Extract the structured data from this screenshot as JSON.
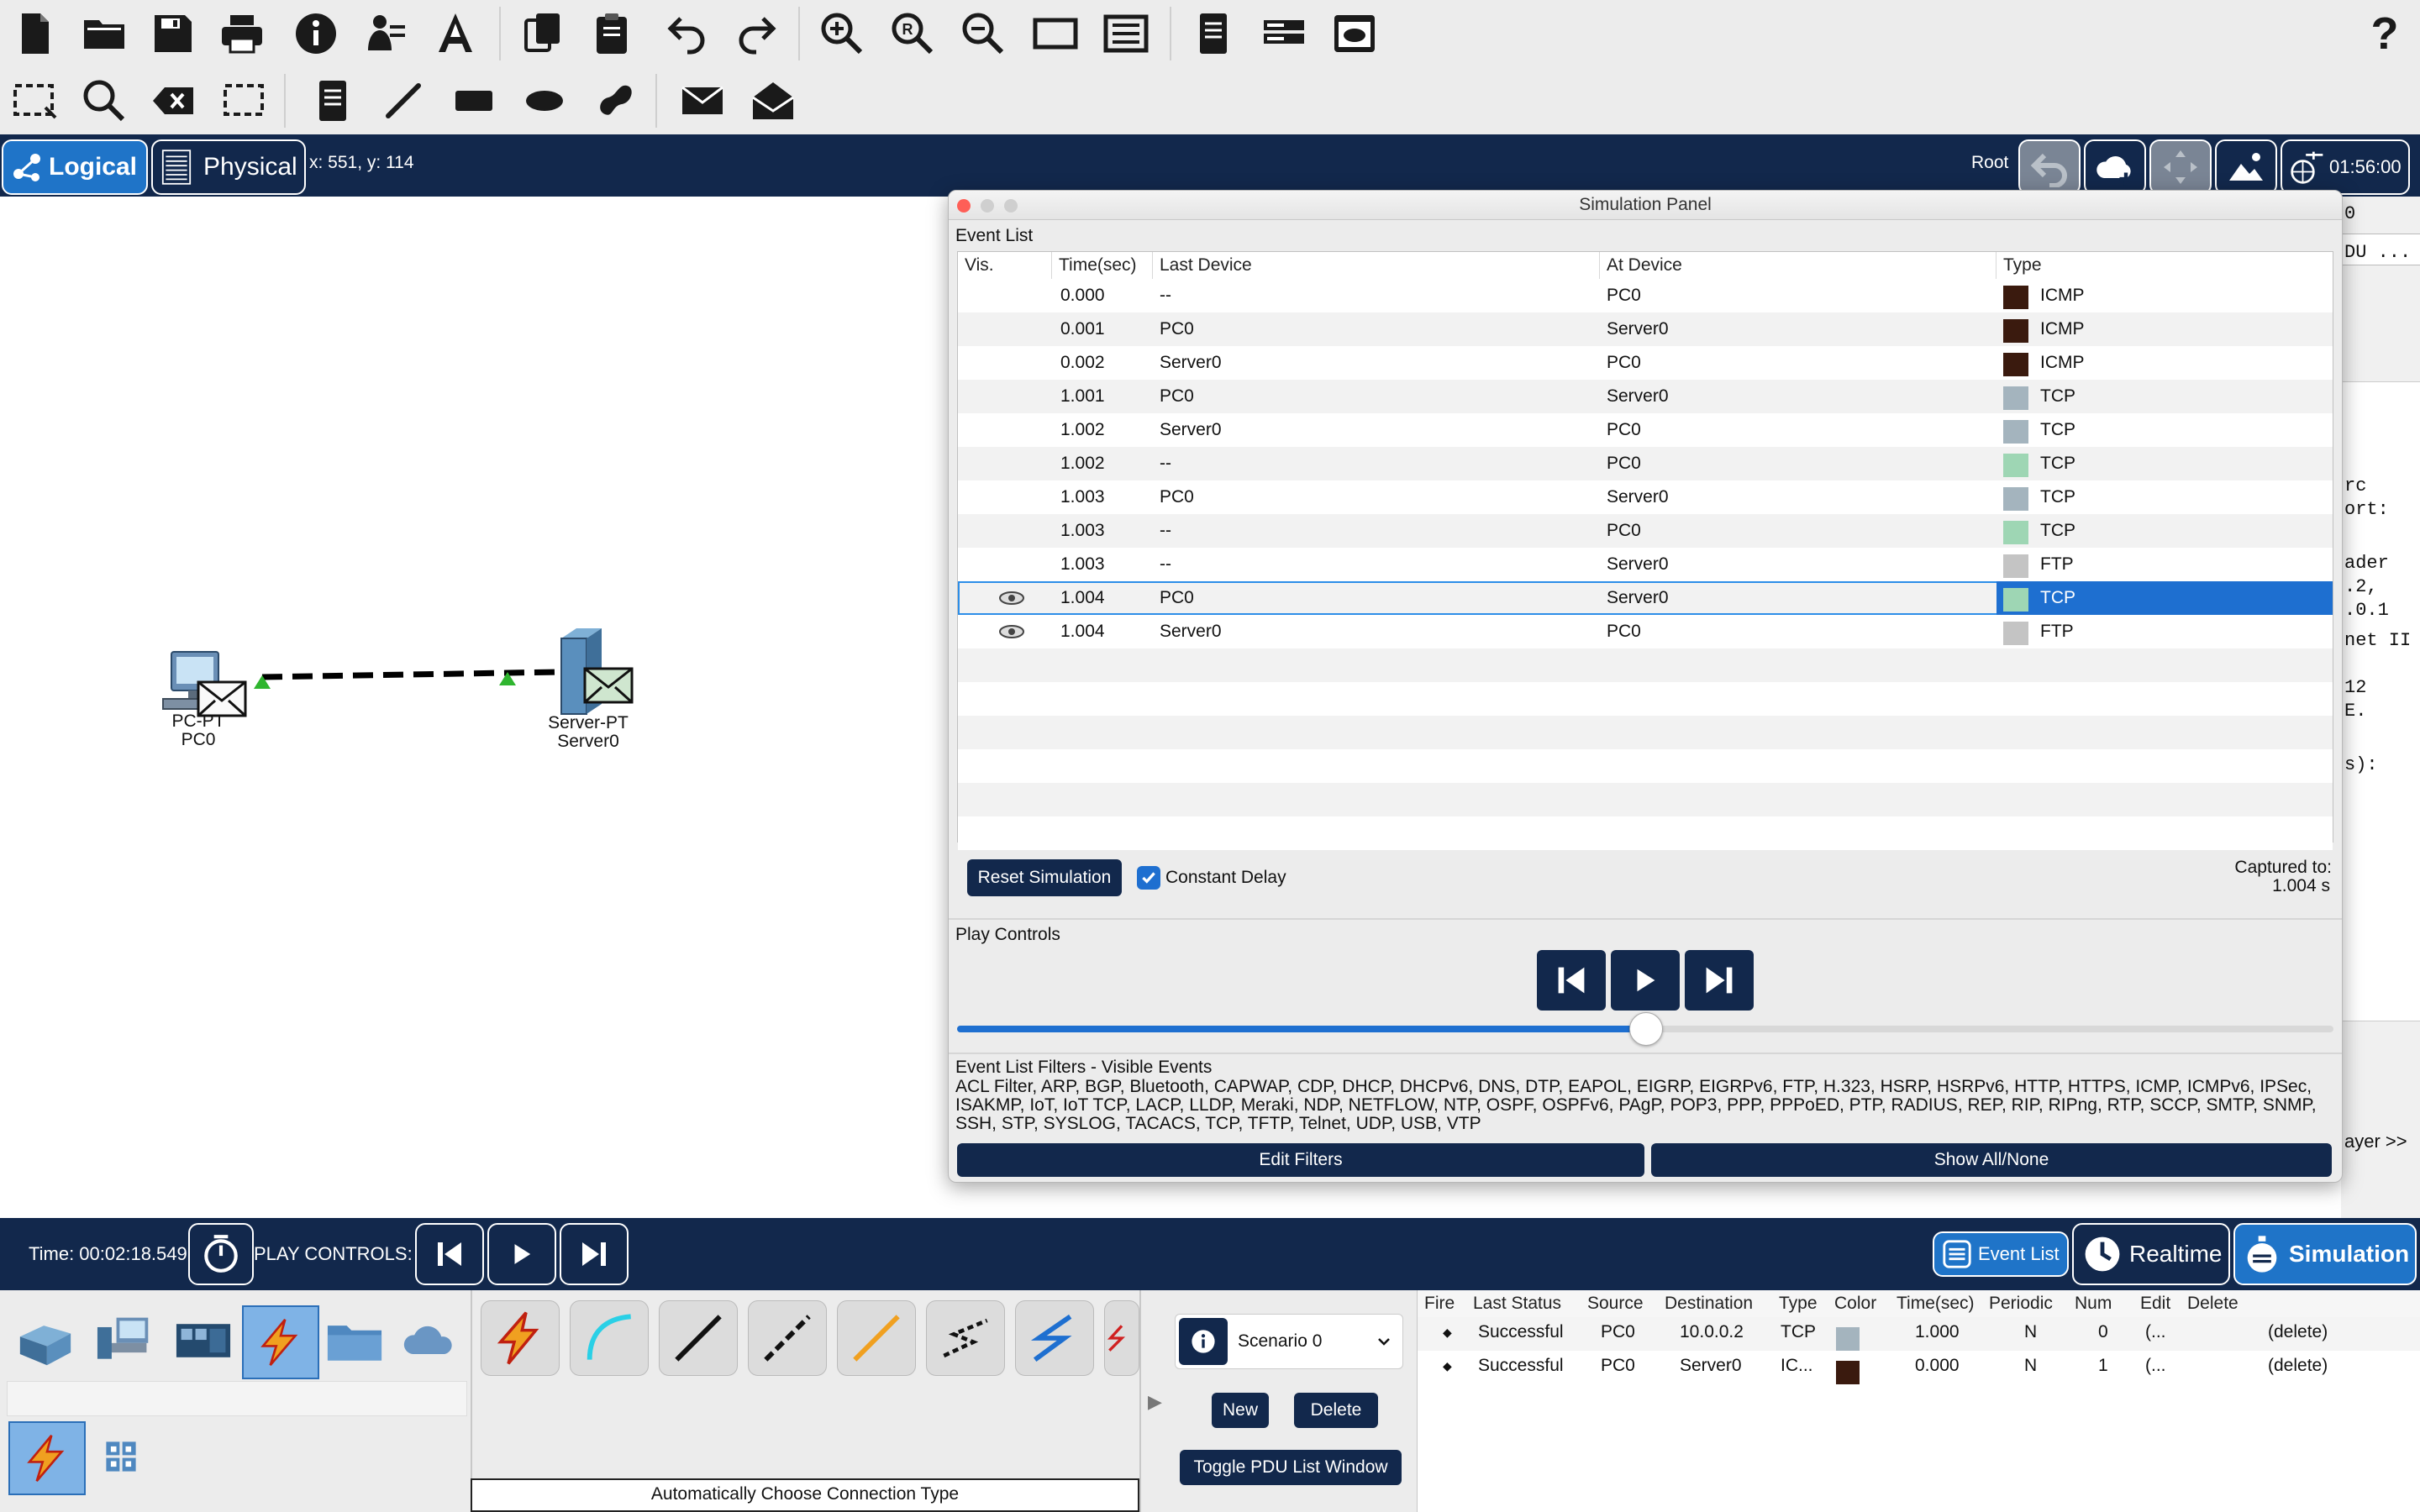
{
  "toolbar_icons": [
    "new-file",
    "open-folder",
    "save",
    "print",
    "info",
    "activity-wizard",
    "text-a",
    "copy",
    "paste",
    "undo",
    "redo",
    "zoom-in",
    "zoom-reset",
    "zoom-out",
    "window",
    "list-view",
    "notes",
    "device-rack",
    "cloud-window",
    "help"
  ],
  "help_label": "?",
  "nav": {
    "logical_label": "Logical",
    "physical_label": "Physical",
    "coords": "x: 551, y: 114",
    "root_label": "Root",
    "clock": "01:56:00"
  },
  "devices": {
    "pc": {
      "type": "PC-PT",
      "name": "PC0"
    },
    "server": {
      "type": "Server-PT",
      "name": "Server0"
    }
  },
  "sim_panel": {
    "title": "Simulation Panel",
    "event_list_label": "Event List",
    "columns": [
      "Vis.",
      "Time(sec)",
      "Last Device",
      "At Device",
      "Type"
    ],
    "events": [
      {
        "time": "0.000",
        "last": "--",
        "at": "PC0",
        "type": "ICMP",
        "color": "#3a1a0e",
        "vis": false,
        "selected": false
      },
      {
        "time": "0.001",
        "last": "PC0",
        "at": "Server0",
        "type": "ICMP",
        "color": "#3a1a0e",
        "vis": false,
        "selected": false
      },
      {
        "time": "0.002",
        "last": "Server0",
        "at": "PC0",
        "type": "ICMP",
        "color": "#3a1a0e",
        "vis": false,
        "selected": false
      },
      {
        "time": "1.001",
        "last": "PC0",
        "at": "Server0",
        "type": "TCP",
        "color": "#a4b4be",
        "vis": false,
        "selected": false
      },
      {
        "time": "1.002",
        "last": "Server0",
        "at": "PC0",
        "type": "TCP",
        "color": "#a4b4be",
        "vis": false,
        "selected": false
      },
      {
        "time": "1.002",
        "last": "--",
        "at": "PC0",
        "type": "TCP",
        "color": "#9ed6b4",
        "vis": false,
        "selected": false
      },
      {
        "time": "1.003",
        "last": "PC0",
        "at": "Server0",
        "type": "TCP",
        "color": "#a4b4be",
        "vis": false,
        "selected": false
      },
      {
        "time": "1.003",
        "last": "--",
        "at": "PC0",
        "type": "TCP",
        "color": "#9ed6b4",
        "vis": false,
        "selected": false
      },
      {
        "time": "1.003",
        "last": "--",
        "at": "Server0",
        "type": "FTP",
        "color": "#c4c4c4",
        "vis": false,
        "selected": false
      },
      {
        "time": "1.004",
        "last": "PC0",
        "at": "Server0",
        "type": "TCP",
        "color": "#9ed6b4",
        "vis": true,
        "selected": true
      },
      {
        "time": "1.004",
        "last": "Server0",
        "at": "PC0",
        "type": "FTP",
        "color": "#c4c4c4",
        "vis": true,
        "selected": false
      }
    ],
    "reset_label": "Reset Simulation",
    "constant_delay_label": "Constant Delay",
    "constant_delay_checked": true,
    "captured_label": "Captured to:",
    "captured_value": "1.004 s",
    "play_controls_label": "Play Controls",
    "playback_progress": 0.5,
    "filters_label": "Event List Filters - Visible Events",
    "filters_text": "ACL Filter, ARP, BGP, Bluetooth, CAPWAP, CDP, DHCP, DHCPv6, DNS, DTP, EAPOL, EIGRP, EIGRPv6, FTP, H.323, HSRP, HSRPv6, HTTP, HTTPS, ICMP, ICMPv6, IPSec, ISAKMP, IoT, IoT TCP, LACP, LLDP, Meraki, NDP, NETFLOW, NTP, OSPF, OSPFv6, PAgP, POP3, PPP, PPPoED, PTP, RADIUS, REP, RIP, RIPng, RTP, SCCP, SMTP, SNMP, SSH, STP, SYSLOG, TACACS, TCP, TFTP, Telnet, UDP, USB, VTP",
    "edit_filters_label": "Edit Filters",
    "show_all_label": "Show All/None"
  },
  "right_strip": [
    "0",
    "DU ...",
    "rc",
    "ort:",
    "ader",
    ".2,",
    ".0.1",
    "net II",
    "12",
    "E.",
    "s):",
    "ayer >>"
  ],
  "bottom_bar": {
    "time": "Time: 00:02:18.549",
    "play_controls": "PLAY CONTROLS:",
    "event_list": "Event List",
    "realtime": "Realtime",
    "simulation": "Simulation"
  },
  "conn_type_label": "Automatically Choose Connection Type",
  "scenario": {
    "selected": "Scenario 0",
    "new_label": "New",
    "delete_label": "Delete",
    "toggle_label": "Toggle PDU List Window"
  },
  "pdu_table": {
    "columns": [
      "Fire",
      "Last Status",
      "Source",
      "Destination",
      "Type",
      "Color",
      "Time(sec)",
      "Periodic",
      "Num",
      "Edit",
      "Delete"
    ],
    "rows": [
      {
        "status": "Successful",
        "source": "PC0",
        "dest": "10.0.0.2",
        "type": "TCP",
        "color": "#a4b4be",
        "time": "1.000",
        "periodic": "N",
        "num": "0",
        "edit": "(...",
        "delete": "(delete)"
      },
      {
        "status": "Successful",
        "source": "PC0",
        "dest": "Server0",
        "type": "IC...",
        "color": "#3a1a0e",
        "time": "0.000",
        "periodic": "N",
        "num": "1",
        "edit": "(...",
        "delete": "(delete)"
      }
    ]
  }
}
